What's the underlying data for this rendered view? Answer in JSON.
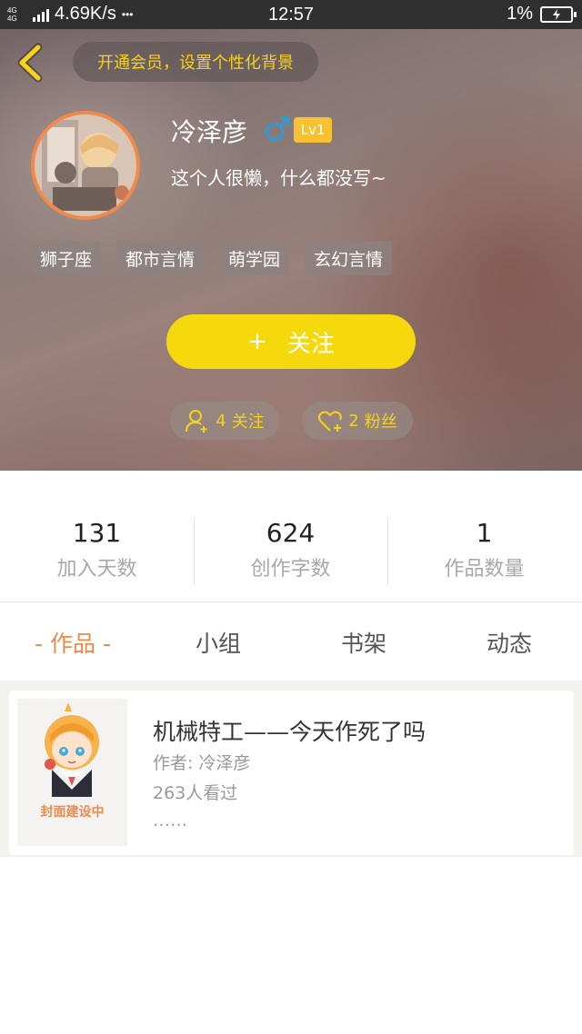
{
  "status_bar": {
    "network": "4G 4G",
    "speed": "4.69K/s",
    "more": "•••",
    "time": "12:57",
    "battery": "1%"
  },
  "header": {
    "vip_text": "开通会员，设置个性化背景",
    "name": "冷泽彦",
    "gender_symbol": "♂",
    "level": "Lv1",
    "bio": "这个人很懒，什么都没写~",
    "tags": [
      "狮子座",
      "都市言情",
      "萌学园",
      "玄幻言情"
    ],
    "follow_button": {
      "plus": "+",
      "label": "关注"
    },
    "following": {
      "count": "4",
      "label": "关注"
    },
    "fans": {
      "count": "2",
      "label": "粉丝"
    }
  },
  "stats": [
    {
      "value": "131",
      "label": "加入天数"
    },
    {
      "value": "624",
      "label": "创作字数"
    },
    {
      "value": "1",
      "label": "作品数量"
    }
  ],
  "tabs": [
    {
      "label": "- 作品 -",
      "active": true
    },
    {
      "label": "小组",
      "active": false
    },
    {
      "label": "书架",
      "active": false
    },
    {
      "label": "动态",
      "active": false
    }
  ],
  "books": [
    {
      "cover_label": "封面建设中",
      "title": "机械特工——今天作死了吗",
      "author": "作者: 冷泽彦",
      "views": "263人看过",
      "desc": "……"
    }
  ],
  "colors": {
    "accent_orange": "#f08a4b",
    "accent_yellow": "#f6d90c",
    "male_blue": "#2f9bd6"
  }
}
